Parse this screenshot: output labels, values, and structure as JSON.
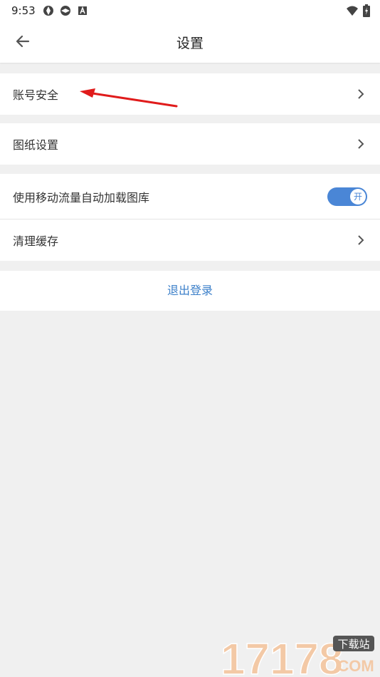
{
  "status": {
    "time": "9:53"
  },
  "appbar": {
    "title": "设置"
  },
  "groups": [
    {
      "label": "账号安全"
    },
    {
      "label": "图纸设置"
    },
    {
      "label": "使用移动流量自动加载图库",
      "toggle_text": "开"
    },
    {
      "label": "清理缓存"
    }
  ],
  "logout": {
    "label": "退出登录"
  },
  "watermark": {
    "number": "17178",
    "top": "下载站",
    "bottom": ".COM"
  },
  "colors": {
    "accent": "#4a86d6",
    "link": "#3b7fc9",
    "annotation": "#e01b1b"
  }
}
